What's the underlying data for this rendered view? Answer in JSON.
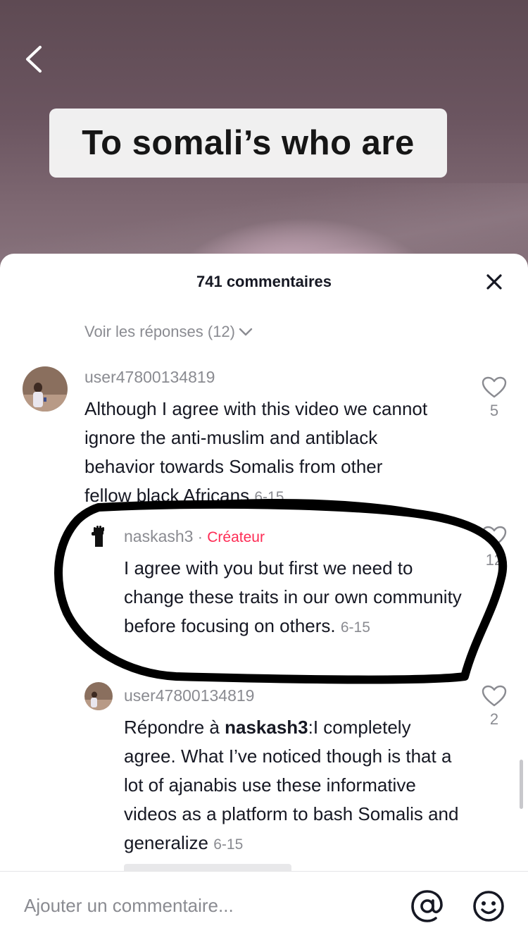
{
  "video": {
    "caption": "To somali’s who are"
  },
  "sheet": {
    "title": "741 commentaires",
    "view_replies": "Voir les réponses (12)"
  },
  "comments": [
    {
      "username": "user47800134819",
      "text": "Although I agree with this video we cannot ignore the anti-muslim and antiblack behavior towards Somalis from other fellow black Africans",
      "date": "6-15",
      "likes": "5"
    },
    {
      "username": "naskash3",
      "separator": "·",
      "badge": "Créateur",
      "text": "I agree with you but first we need to change these traits in our own community before focusing on others.",
      "date": "6-15",
      "likes": "12"
    },
    {
      "username": "user47800134819",
      "reply_prefix": "Répondre à ",
      "reply_to": "naskash3",
      "text": ":I completely agree. What I’ve noticed though is that a lot of ajanabis use these informative videos as a platform to bash Somalis and generalize",
      "date": "6-15",
      "likes": "2"
    }
  ],
  "input": {
    "placeholder": "Ajouter un commentaire..."
  },
  "icons": {
    "back": "chevron-left-icon",
    "close": "close-icon",
    "like": "heart-outline-icon",
    "mention": "at-sign-icon",
    "emoji": "smiley-icon",
    "creator_avatar": "raised-fist-icon"
  },
  "colors": {
    "creator_badge": "#fe2c55",
    "secondary_text": "#8a8b91",
    "primary_text": "#161823",
    "annotation_stroke": "#000000"
  }
}
